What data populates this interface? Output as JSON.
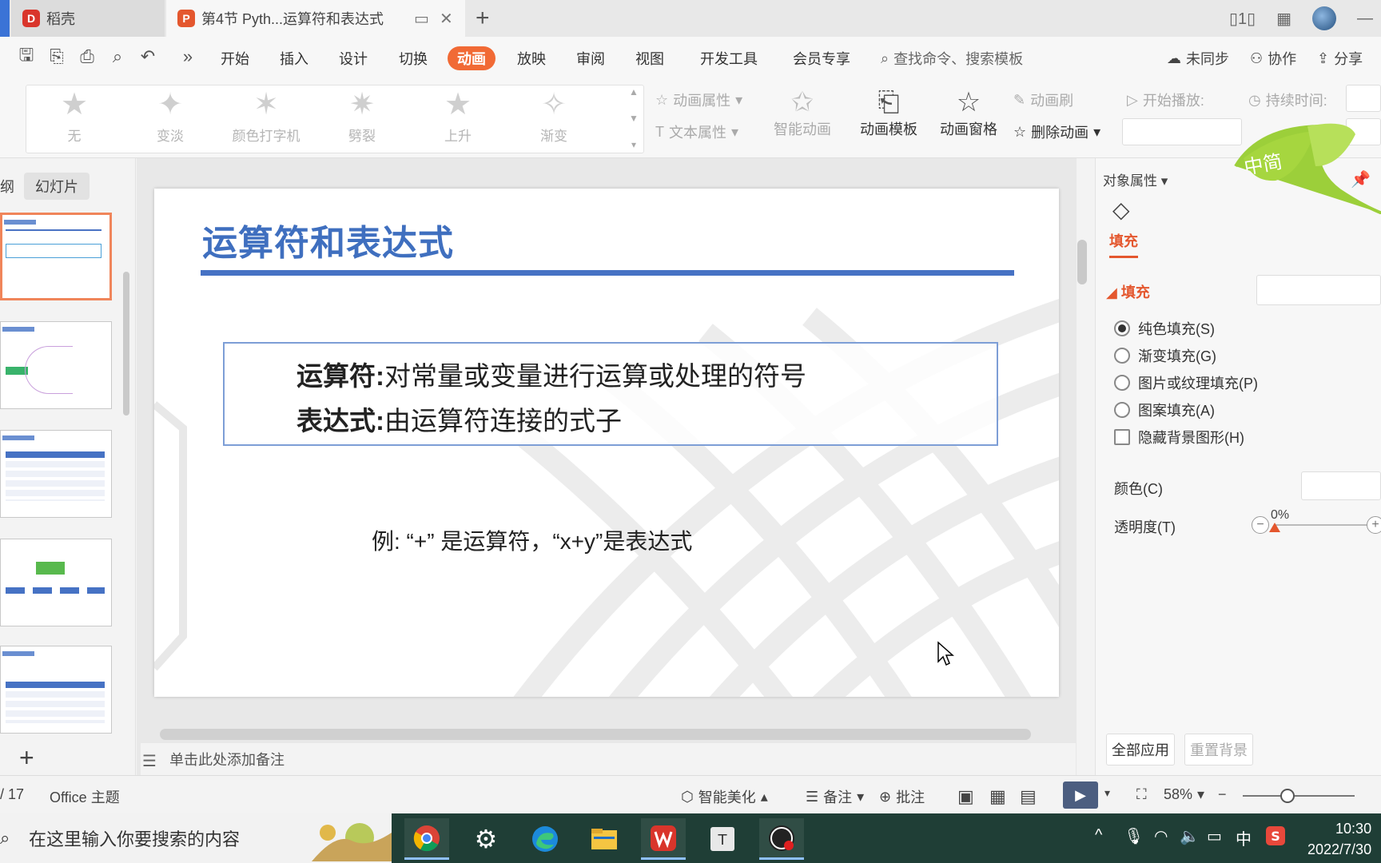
{
  "titlebar": {
    "tabs": [
      {
        "label": "稻壳",
        "icon": "wps-docer-icon"
      },
      {
        "label": "第4节 Pyth...运算符和表达式",
        "icon": "wps-presentation-icon"
      }
    ],
    "new_tab": "+"
  },
  "menu": {
    "items": [
      "开始",
      "插入",
      "设计",
      "切换",
      "动画",
      "放映",
      "审阅",
      "视图",
      "开发工具",
      "会员专享"
    ],
    "active": "动画",
    "search_placeholder": "查找命令、搜索模板",
    "unsynced": "未同步",
    "collab": "协作",
    "share": "分享"
  },
  "ribbon": {
    "animations": [
      "无",
      "变淡",
      "颜色打字机",
      "劈裂",
      "上升",
      "渐变"
    ],
    "anim_props": "动画属性",
    "text_props": "文本属性",
    "smart_anim": "智能动画",
    "anim_template": "动画模板",
    "anim_pane": "动画窗格",
    "anim_brush": "动画刷",
    "delete_anim": "删除动画",
    "start_play": "开始播放:",
    "duration": "持续时间:"
  },
  "left_panel": {
    "tab_outline": "纲",
    "tab_slides": "幻灯片"
  },
  "slide": {
    "title": "运算符和表达式",
    "def1_term": "运算符:",
    "def1_text": "对常量或变量进行运算或处理的符号",
    "def2_term": "表达式:",
    "def2_text": "由运算符连接的式子",
    "example": "例: “+” 是运算符，“x+y”是表达式"
  },
  "notes_placeholder": "单击此处添加备注",
  "right_panel": {
    "header": "对象属性",
    "fill_tab": "填充",
    "section": "填充",
    "options": [
      "纯色填充(S)",
      "渐变填充(G)",
      "图片或纹理填充(P)",
      "图案填充(A)"
    ],
    "selected_option": "纯色填充(S)",
    "hide_bg": "隐藏背景图形(H)",
    "color_label": "颜色(C)",
    "transparency_label": "透明度(T)",
    "transparency_value": "0%",
    "apply_all": "全部应用",
    "reset_bg": "重置背景",
    "logo_text": "中简"
  },
  "statusbar": {
    "page": "/ 17",
    "theme": "Office 主题",
    "beautify": "智能美化",
    "notes": "备注",
    "comments": "批注",
    "zoom": "58%"
  },
  "taskbar": {
    "search_placeholder": "在这里输入你要搜索的内容",
    "ime": "中",
    "time": "10:30",
    "date": "2022/7/30"
  },
  "colors": {
    "accent": "#f16a35",
    "slide_title": "#3f6fbf",
    "rule": "#4672c4"
  }
}
